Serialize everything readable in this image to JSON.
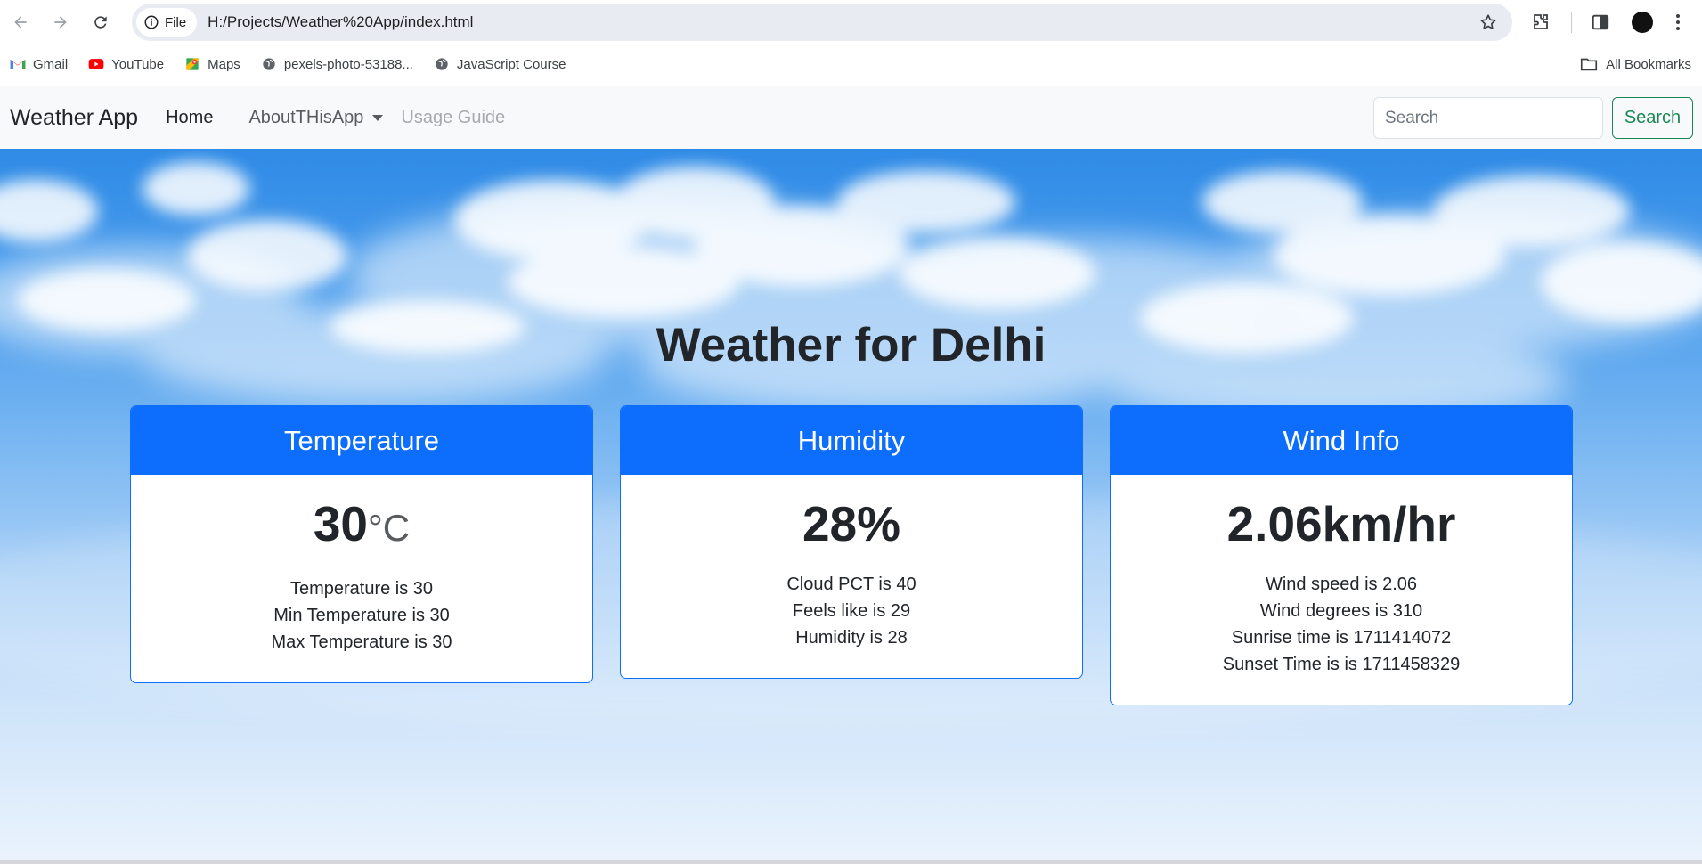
{
  "browser": {
    "site_chip": "File",
    "url": "H:/Projects/Weather%20App/index.html"
  },
  "bookmarks": {
    "items": [
      {
        "label": "Gmail",
        "icon": "gmail-icon"
      },
      {
        "label": "YouTube",
        "icon": "youtube-icon"
      },
      {
        "label": "Maps",
        "icon": "maps-icon"
      },
      {
        "label": "pexels-photo-53188...",
        "icon": "globe-icon"
      },
      {
        "label": "JavaScript Course",
        "icon": "globe-icon"
      }
    ],
    "all_bookmarks": "All Bookmarks"
  },
  "navbar": {
    "brand": "Weather App",
    "home": "Home",
    "about": "AboutTHisApp",
    "guide": "Usage Guide",
    "search_placeholder": "Search",
    "search_button": "Search"
  },
  "main": {
    "title": "Weather for Delhi",
    "cards": [
      {
        "header": "Temperature",
        "value": "30",
        "unit": "°C",
        "details": [
          "Temperature is 30",
          "Min Temperature is 30",
          "Max Temperature is 30"
        ]
      },
      {
        "header": "Humidity",
        "value": "28%",
        "details": [
          "Cloud PCT is 40",
          "Feels like is 29",
          "Humidity is 28"
        ]
      },
      {
        "header": "Wind Info",
        "value": "2.06km/hr",
        "details": [
          "Wind speed is 2.06",
          "Wind degrees is 310",
          "Sunrise time is 1711414072",
          "Sunset Time is is 1711458329"
        ]
      }
    ]
  },
  "colors": {
    "primary": "#0d6efd",
    "success": "#198754",
    "navbar_bg": "#f8f9fa",
    "text": "#212529"
  }
}
